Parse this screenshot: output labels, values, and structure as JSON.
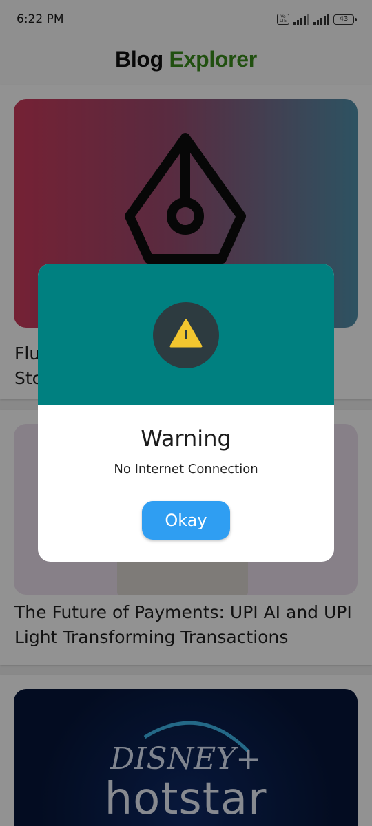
{
  "status_bar": {
    "time": "6:22 PM",
    "volte": "Vo LTE",
    "battery": "43"
  },
  "app_bar": {
    "title_part1": "Blog",
    "title_part2": "Explorer"
  },
  "feed": {
    "cards": [
      {
        "title": "Flu\nSto"
      },
      {
        "title": "The Future of Payments: UPI AI and UPI Light Transforming Transactions"
      },
      {
        "title": ""
      }
    ],
    "card3_image": {
      "brand_line1": "DISNEY+",
      "brand_line2": "hotstar"
    }
  },
  "dialog": {
    "title": "Warning",
    "message": "No Internet Connection",
    "button_label": "Okay",
    "header_color": "#008080",
    "button_color": "#2f9ef2",
    "icon": "warning-triangle-icon"
  }
}
